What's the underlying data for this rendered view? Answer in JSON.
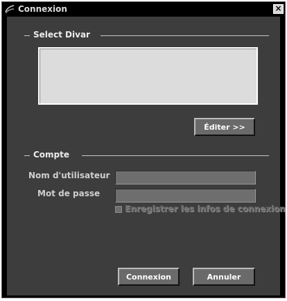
{
  "window": {
    "title": "Connexion",
    "icon": "cable-connector-icon",
    "close_label": "×"
  },
  "divar_group": {
    "label": "Select Divar",
    "edit_button": "Éditer >>"
  },
  "account_group": {
    "label": "Compte",
    "username_label": "Nom d'utilisateur",
    "username_value": "",
    "password_label": "Mot de passe",
    "password_value": "",
    "remember_label": "Enregistrer les infos de connexion",
    "remember_checked": false
  },
  "buttons": {
    "connect": "Connexion",
    "cancel": "Annuler"
  }
}
